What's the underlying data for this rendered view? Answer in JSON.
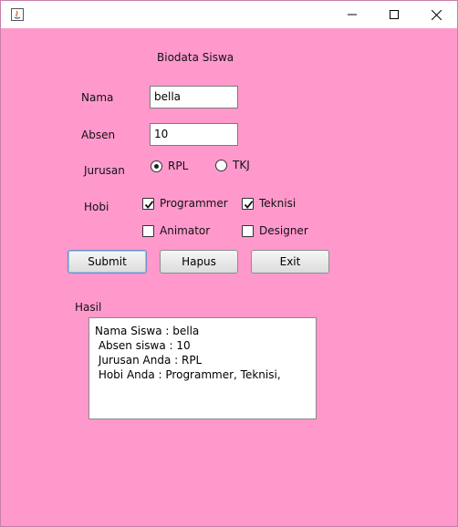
{
  "window": {
    "title": "",
    "app_icon": "java-icon",
    "controls": [
      "minimize-icon",
      "maximize-icon",
      "close-icon"
    ]
  },
  "form": {
    "heading": "Biodata Siswa",
    "nama_label": "Nama",
    "nama_value": "bella",
    "absen_label": "Absen",
    "absen_value": "10",
    "jurusan_label": "Jurusan",
    "jurusan_options": [
      {
        "label": "RPL",
        "selected": true
      },
      {
        "label": "TKJ",
        "selected": false
      }
    ],
    "hobi_label": "Hobi",
    "hobi_options": [
      {
        "label": "Programmer",
        "checked": true
      },
      {
        "label": "Teknisi",
        "checked": true
      },
      {
        "label": "Animator",
        "checked": false
      },
      {
        "label": "Designer",
        "checked": false
      }
    ],
    "buttons": {
      "submit": "Submit",
      "hapus": "Hapus",
      "exit": "Exit"
    },
    "hasil_label": "Hasil",
    "hasil_lines": [
      "Nama Siswa : bella",
      " Absen siswa : 10",
      " Jurusan Anda : RPL",
      " Hobi Anda : Programmer, Teknisi,"
    ]
  },
  "colors": {
    "background": "#ff99cc",
    "titlebar": "#ffffff"
  }
}
